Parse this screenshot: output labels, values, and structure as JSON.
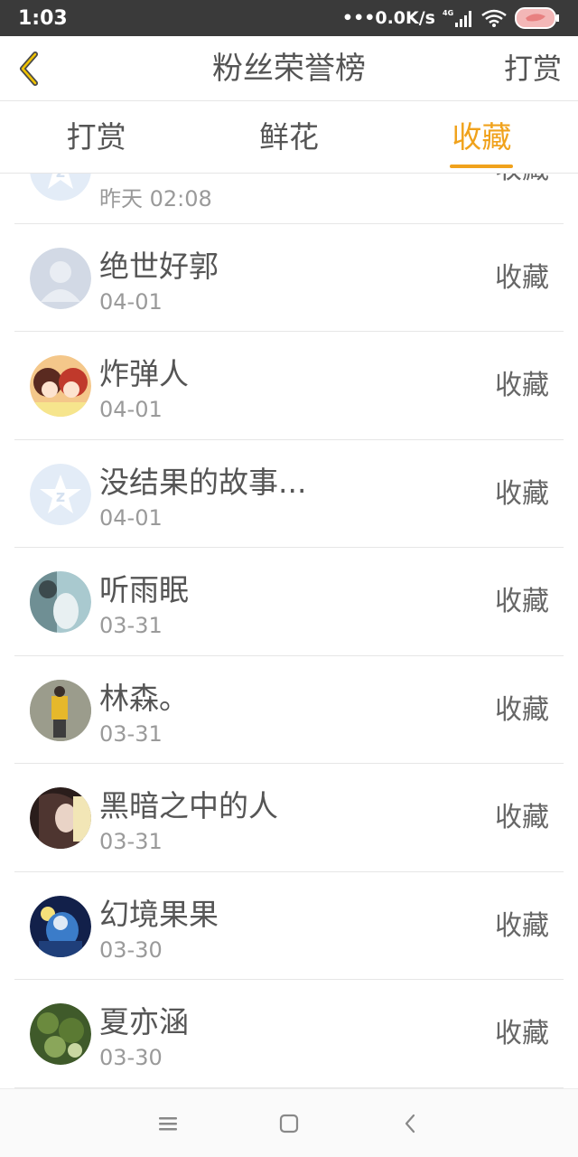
{
  "status_bar": {
    "time": "1:03",
    "network_speed": "0.0K/s",
    "network_type": "4G"
  },
  "header": {
    "title": "粉丝荣誉榜",
    "right_button": "打赏"
  },
  "tabs": [
    {
      "label": "打赏",
      "active": false
    },
    {
      "label": "鲜花",
      "active": false
    },
    {
      "label": "收藏",
      "active": true
    }
  ],
  "colors": {
    "accent": "#f0a21c",
    "text": "#555555",
    "subtext": "#9a9a9a",
    "divider": "#e6e6e6",
    "status_bar": "#3a3a3a"
  },
  "list": [
    {
      "name": "",
      "date": "昨天 02:08",
      "action": "收藏",
      "avatar": "default-star-avatar"
    },
    {
      "name": "绝世好郭",
      "date": "04-01",
      "action": "收藏",
      "avatar": "default-person-avatar"
    },
    {
      "name": "炸弹人",
      "date": "04-01",
      "action": "收藏",
      "avatar": "anime-girls-avatar"
    },
    {
      "name": "没结果的故事...",
      "date": "04-01",
      "action": "收藏",
      "avatar": "default-star-avatar"
    },
    {
      "name": "听雨眠",
      "date": "03-31",
      "action": "收藏",
      "avatar": "photo-avatar"
    },
    {
      "name": "林森。",
      "date": "03-31",
      "action": "收藏",
      "avatar": "photo-avatar"
    },
    {
      "name": "黑暗之中的人",
      "date": "03-31",
      "action": "收藏",
      "avatar": "photo-avatar"
    },
    {
      "name": "幻境果果",
      "date": "03-30",
      "action": "收藏",
      "avatar": "anime-blue-avatar"
    },
    {
      "name": "夏亦涵",
      "date": "03-30",
      "action": "收藏",
      "avatar": "nature-avatar"
    }
  ]
}
